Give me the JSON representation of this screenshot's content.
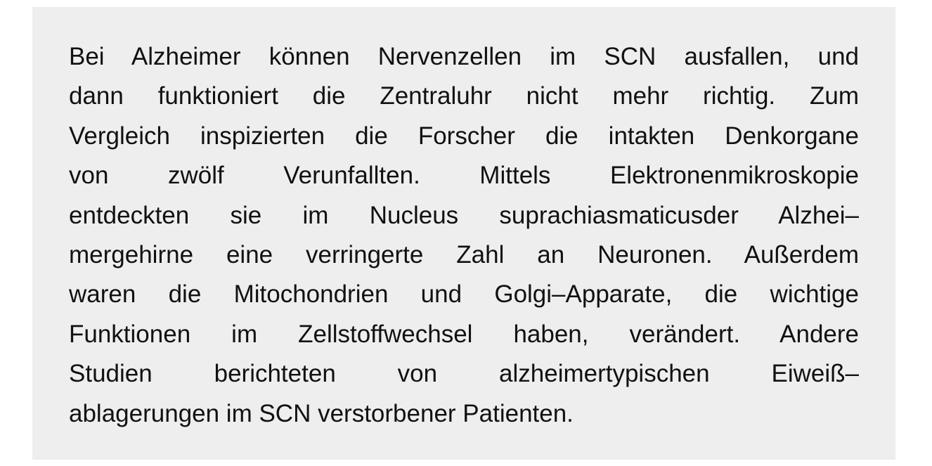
{
  "paragraph": {
    "lines": [
      "Bei Alzheimer können Nervenzellen im SCN ausfallen, und",
      "dann funktioniert die Zentraluhr nicht mehr richtig. Zum",
      "Vergleich inspizierten die Forscher die intakten Denkorgane",
      "von zwölf Verunfallten. Mittels Elektronenmikroskopie",
      "entdeckten sie im Nucleus suprachiasmaticusder Alzhei–",
      "mergehirne eine verringerte Zahl an Neuronen. Außerdem",
      "waren die Mitochondrien und Golgi–Apparate, die wichtige",
      "Funktionen im Zellstoffwechsel haben, verändert. Andere",
      "Studien berichteten von alzheimertypischen Eiweiß–",
      "ablagerungen im SCN verstorbener Patienten."
    ]
  }
}
